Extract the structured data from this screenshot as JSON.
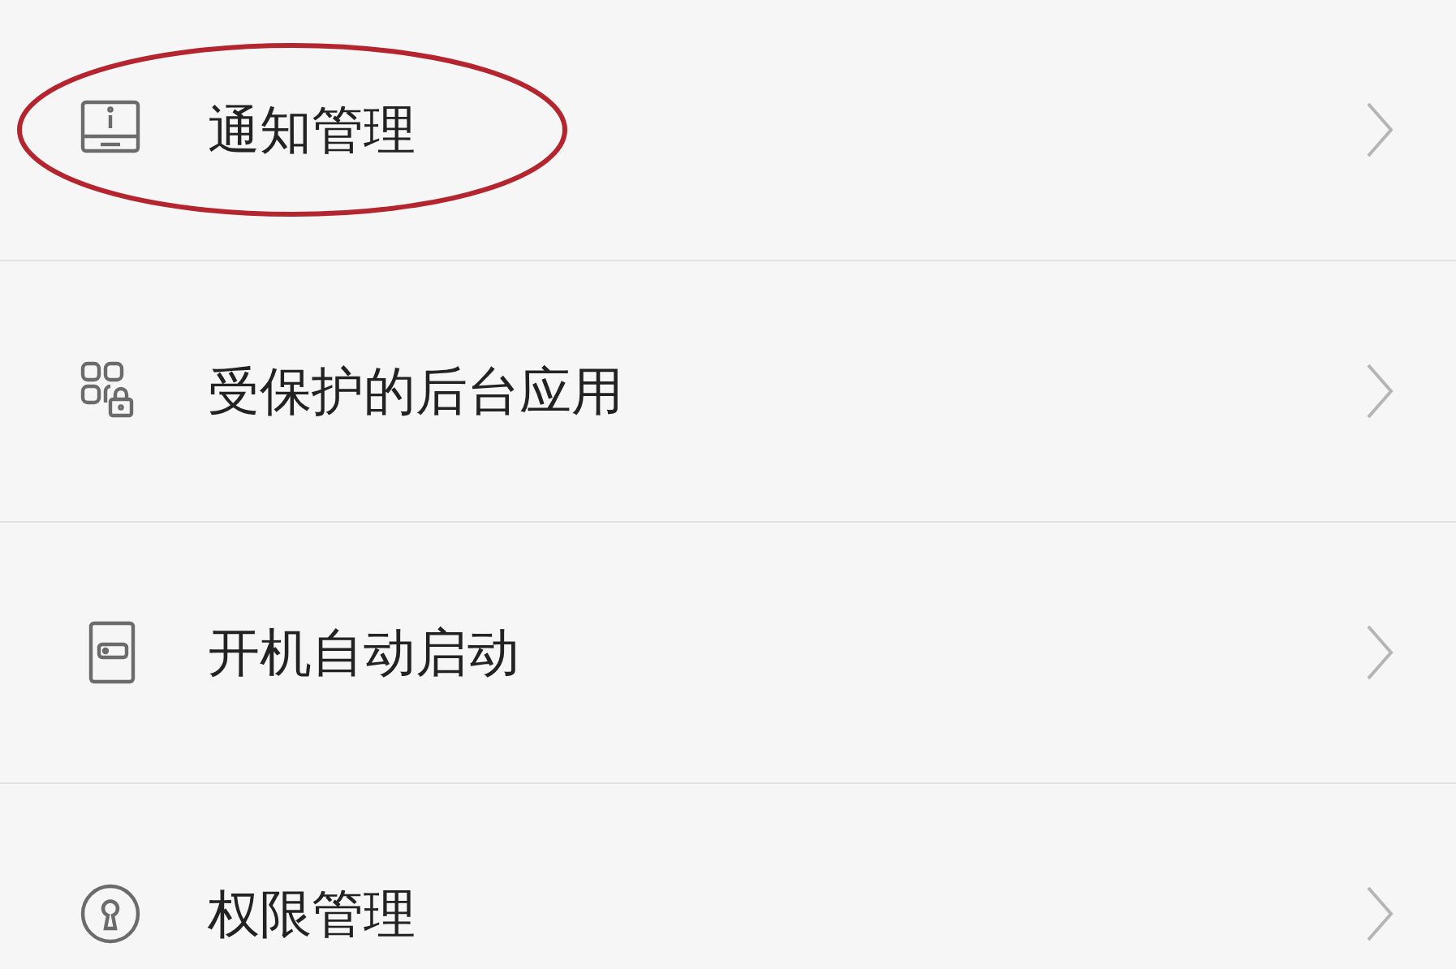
{
  "items": [
    {
      "kind": "notification",
      "label": "通知管理",
      "circled": true
    },
    {
      "kind": "protected-apps",
      "label": "受保护的后台应用",
      "circled": false
    },
    {
      "kind": "autostart",
      "label": "开机自动启动",
      "circled": false
    },
    {
      "kind": "permissions",
      "label": "权限管理",
      "circled": false
    }
  ]
}
